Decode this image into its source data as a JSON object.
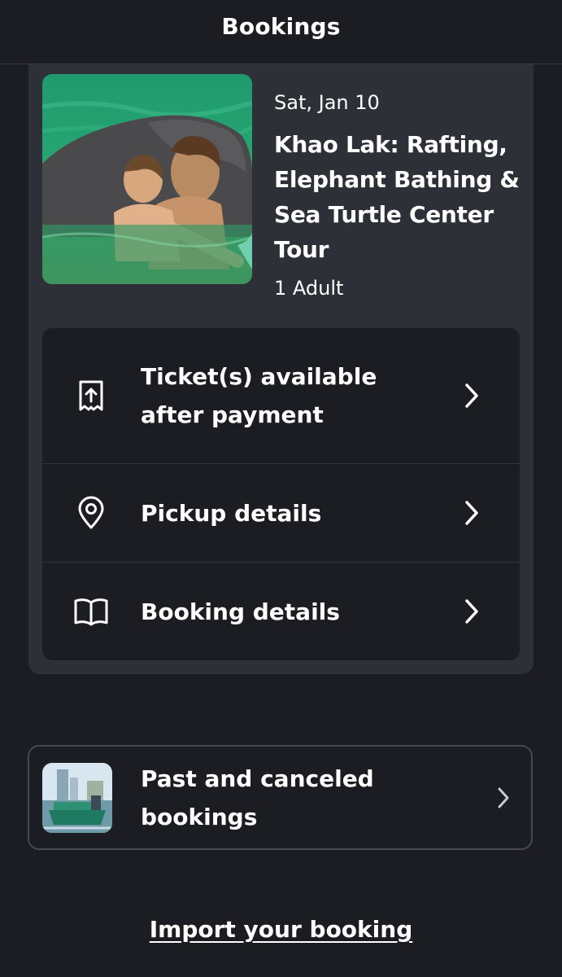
{
  "header": {
    "title": "Bookings"
  },
  "booking": {
    "date": "Sat, Jan 10",
    "title": "Khao Lak: Rafting, Elephant Bathing & Sea Turtle Center Tour",
    "participants": "1 Adult",
    "image": "elephant-bathing-photo",
    "actions": [
      {
        "label": "Ticket(s) available after payment",
        "icon": "ticket-icon"
      },
      {
        "label": "Pickup details",
        "icon": "location-pin-icon"
      },
      {
        "label": "Booking details",
        "icon": "book-icon"
      }
    ]
  },
  "past": {
    "label": "Past and canceled bookings",
    "image": "boat-photo"
  },
  "import": {
    "label": "Import your booking"
  },
  "colors": {
    "background": "#1c1d22",
    "card": "#2e3037",
    "text": "#ffffff"
  }
}
